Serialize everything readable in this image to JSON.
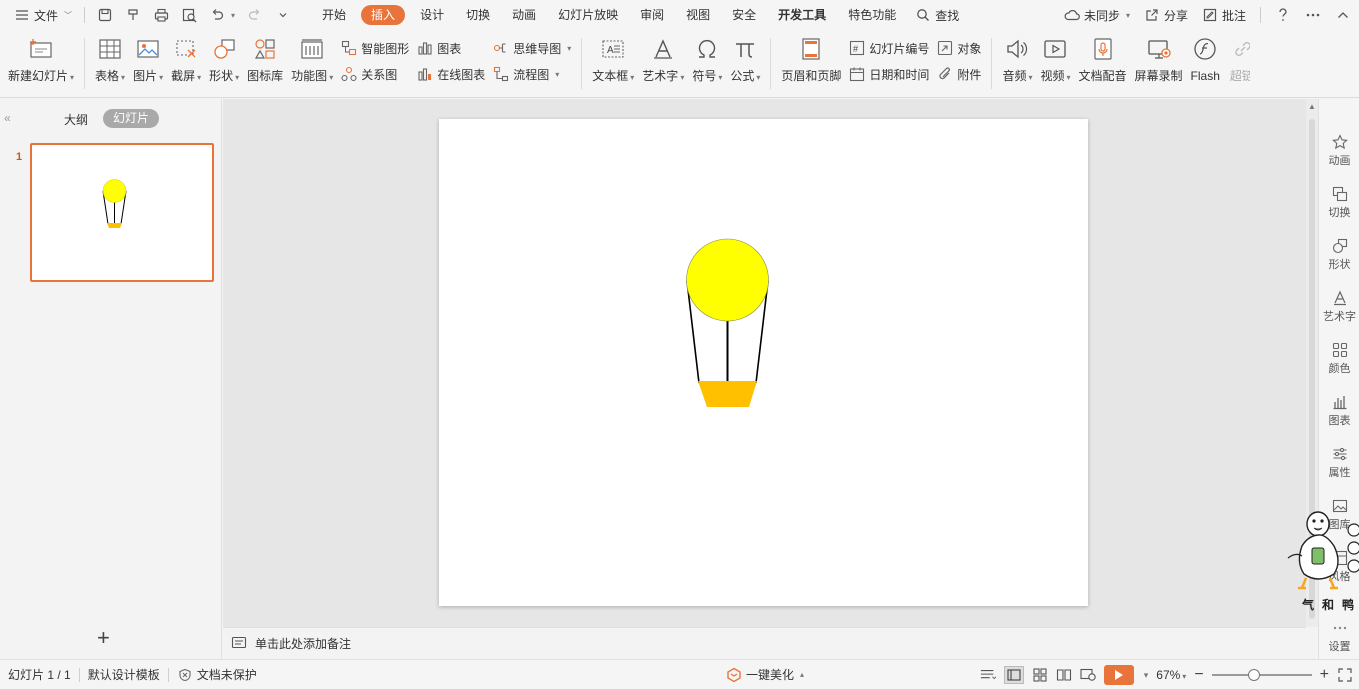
{
  "menubar": {
    "file": "文件",
    "tabs": [
      {
        "label": "开始",
        "active": false,
        "bold": false
      },
      {
        "label": "插入",
        "active": true,
        "bold": false
      },
      {
        "label": "设计",
        "active": false,
        "bold": false
      },
      {
        "label": "切换",
        "active": false,
        "bold": false
      },
      {
        "label": "动画",
        "active": false,
        "bold": false
      },
      {
        "label": "幻灯片放映",
        "active": false,
        "bold": false
      },
      {
        "label": "审阅",
        "active": false,
        "bold": false
      },
      {
        "label": "视图",
        "active": false,
        "bold": false
      },
      {
        "label": "安全",
        "active": false,
        "bold": false
      },
      {
        "label": "开发工具",
        "active": false,
        "bold": true
      },
      {
        "label": "特色功能",
        "active": false,
        "bold": false
      }
    ],
    "search": "查找",
    "sync": "未同步",
    "share": "分享",
    "comment": "批注",
    "accent": "#e8743b"
  },
  "ribbon": {
    "new_slide": "新建幻灯片",
    "table": "表格",
    "picture": "图片",
    "screenshot": "截屏",
    "shape": "形状",
    "icon_lib": "图标库",
    "function_chart": "功能图",
    "smart_art": "智能图形",
    "chart": "图表",
    "relation": "关系图",
    "online_chart": "在线图表",
    "mind_map": "思维导图",
    "flowchart": "流程图",
    "textbox": "文本框",
    "wordart": "艺术字",
    "symbol": "符号",
    "formula": "公式",
    "header_footer": "页眉和页脚",
    "slide_number": "幻灯片编号",
    "object": "对象",
    "date_time": "日期和时间",
    "attachment": "附件",
    "audio": "音频",
    "video": "视频",
    "doc_voice": "文档配音",
    "screen_record": "屏幕录制",
    "flash": "Flash",
    "hyperlink": "超链"
  },
  "leftpane": {
    "outline": "大纲",
    "slides": "幻灯片",
    "slide_number": "1"
  },
  "notes": {
    "placeholder": "单击此处添加备注"
  },
  "rightpanel": {
    "items": [
      "动画",
      "切换",
      "形状",
      "艺术字",
      "颜色",
      "图表",
      "属性",
      "图库",
      "风格",
      "设置"
    ]
  },
  "statusbar": {
    "slide_info": "幻灯片 1 / 1",
    "template": "默认设计模板",
    "protection": "文档未保护",
    "beautify": "一键美化",
    "zoom": "67%"
  },
  "mascot": {
    "text": "气和鸭"
  },
  "balloon": {
    "balloon_color": "#ffff00",
    "basket_color": "#ffc000"
  }
}
